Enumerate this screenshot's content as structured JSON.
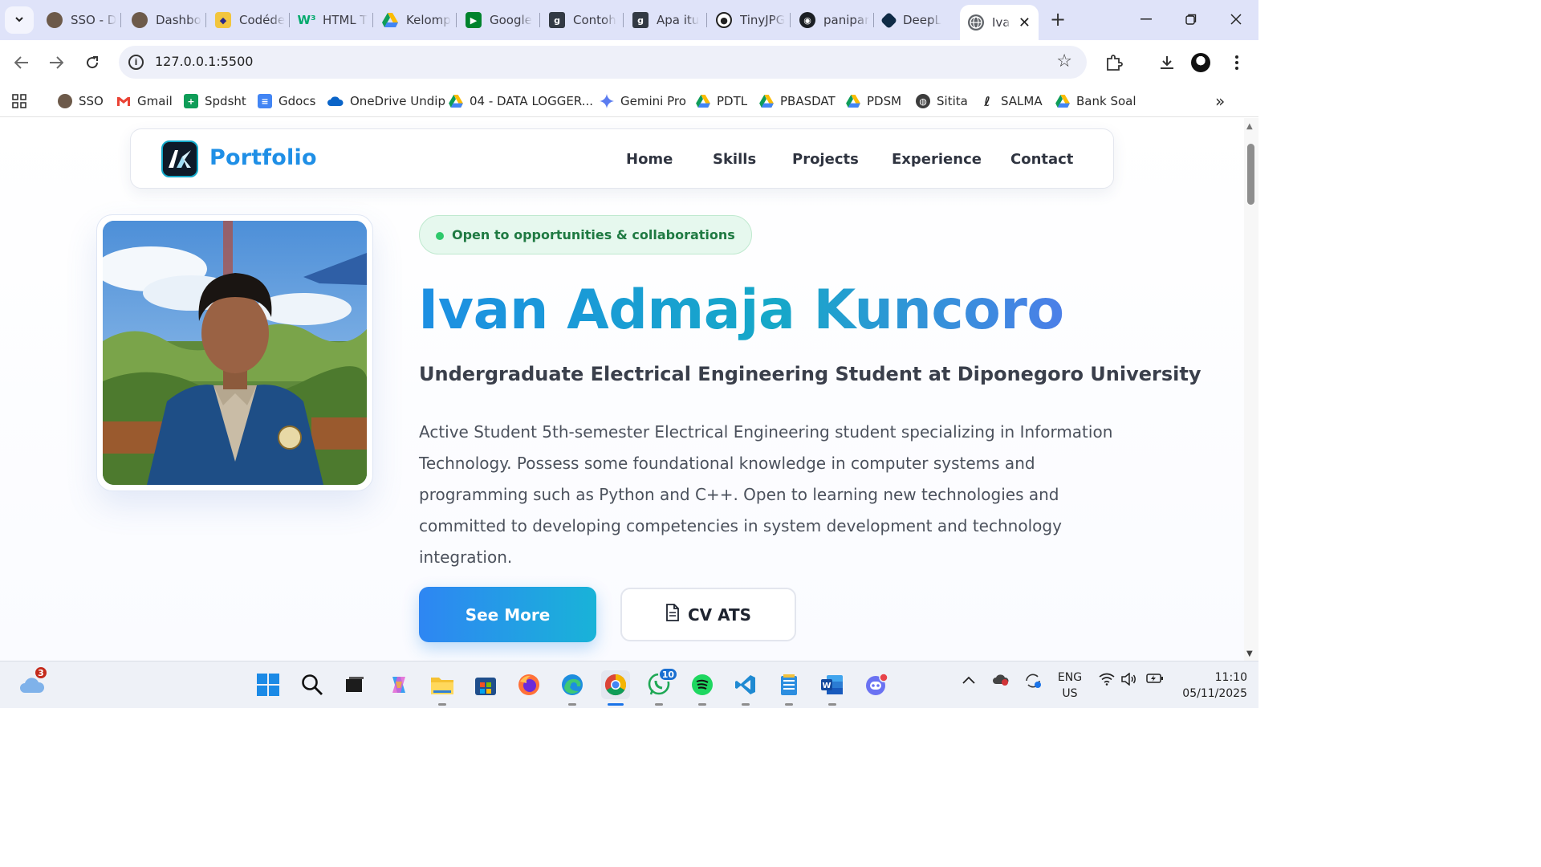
{
  "browser": {
    "tabs": [
      {
        "title": "SSO - D",
        "favicon": "undip-seal-icon"
      },
      {
        "title": "Dashbo",
        "favicon": "undip-seal-icon"
      },
      {
        "title": "Codéde",
        "favicon": "codedex-icon"
      },
      {
        "title": "HTML T",
        "favicon": "w3schools-icon"
      },
      {
        "title": "Kelomp",
        "favicon": "google-drive-icon"
      },
      {
        "title": "Google",
        "favicon": "google-meet-icon"
      },
      {
        "title": "Contoh",
        "favicon": "grammarly-icon"
      },
      {
        "title": "Apa itu",
        "favicon": "grammarly-icon"
      },
      {
        "title": "TinyJPG",
        "favicon": "panda-icon"
      },
      {
        "title": "panipar",
        "favicon": "github-icon"
      },
      {
        "title": "DeepL",
        "favicon": "deepl-icon"
      },
      {
        "title": "Iva",
        "favicon": "globe-icon",
        "active": true
      }
    ],
    "url": "127.0.0.1:5500",
    "bookmarks": [
      {
        "label": "SSO",
        "icon": "undip-seal-icon"
      },
      {
        "label": "Gmail",
        "icon": "gmail-icon"
      },
      {
        "label": "Spdsht",
        "icon": "google-sheets-icon"
      },
      {
        "label": "Gdocs",
        "icon": "google-docs-icon"
      },
      {
        "label": "OneDrive Undip",
        "icon": "onedrive-icon"
      },
      {
        "label": "04 - DATA LOGGER...",
        "icon": "google-drive-icon"
      },
      {
        "label": "Gemini Pro",
        "icon": "gemini-icon"
      },
      {
        "label": "PDTL",
        "icon": "google-drive-icon"
      },
      {
        "label": "PBASDAT",
        "icon": "google-drive-icon"
      },
      {
        "label": "PDSM",
        "icon": "google-drive-icon"
      },
      {
        "label": "Sitita",
        "icon": "globe-icon"
      },
      {
        "label": "SALMA",
        "icon": "pen-icon"
      },
      {
        "label": "Bank Soal",
        "icon": "google-drive-icon"
      }
    ]
  },
  "site": {
    "brand": "Portfolio",
    "nav": [
      "Home",
      "Skills",
      "Projects",
      "Experience",
      "Contact"
    ],
    "badge": "Open to opportunities & collaborations",
    "name": "Ivan Admaja Kuncoro",
    "subtitle": "Undergraduate Electrical Engineering Student at Diponegoro University",
    "description": "Active Student 5th-semester Electrical Engineering student specializing in Information Technology. Possess some foundational knowledge in computer systems and programming such as Python and C++. Open to learning new technologies and committed to developing competencies in system development and technology integration.",
    "buttons": {
      "primary": "See More",
      "secondary": "CV ATS"
    }
  },
  "taskbar": {
    "weather_badge": "3",
    "whatsapp_badge": "10",
    "language": [
      "ENG",
      "US"
    ],
    "time": "11:10",
    "date": "05/11/2025"
  },
  "colors": {
    "brand": "#1f8fe6",
    "accent_start": "#2e86f3",
    "accent_end": "#19b3d8",
    "badge_green": "#1f7a42"
  }
}
